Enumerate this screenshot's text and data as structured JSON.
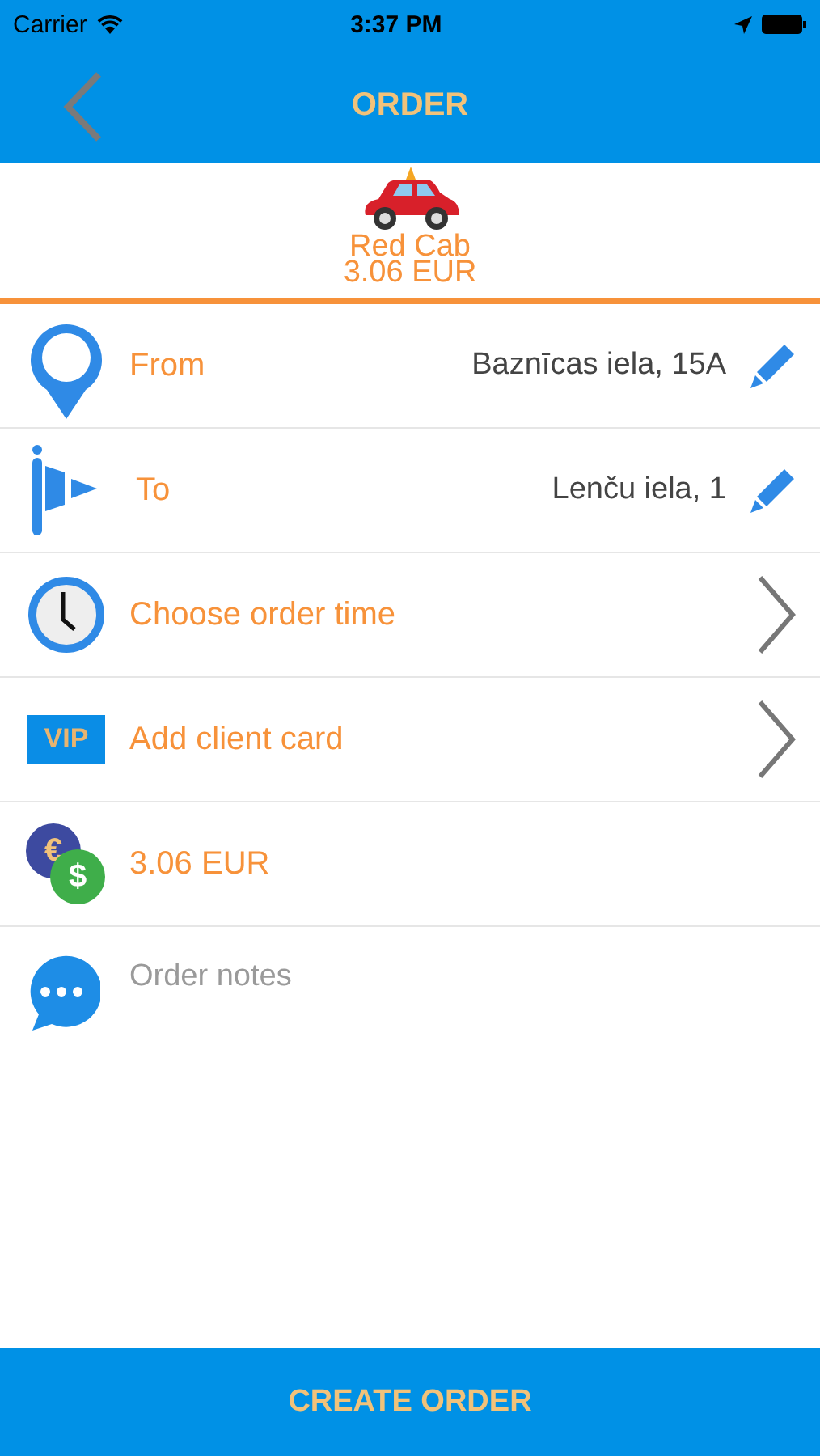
{
  "status_bar": {
    "carrier": "Carrier",
    "time": "3:37 PM"
  },
  "nav": {
    "title": "ORDER"
  },
  "cab": {
    "name": "Red Cab",
    "price": "3.06 EUR"
  },
  "rows": [
    {
      "kind": "from",
      "label": "From",
      "value": "Baznīcas iela, 15A"
    },
    {
      "kind": "to",
      "label": "To",
      "value": "Lenču iela, 1"
    },
    {
      "kind": "time",
      "label": "Choose order time"
    },
    {
      "kind": "vip",
      "badge": "VIP",
      "label": "Add client card"
    },
    {
      "kind": "price",
      "symbols": [
        "€",
        "$"
      ],
      "label": "3.06 EUR"
    }
  ],
  "notes": {
    "placeholder": "Order notes"
  },
  "create_button": "CREATE ORDER"
}
